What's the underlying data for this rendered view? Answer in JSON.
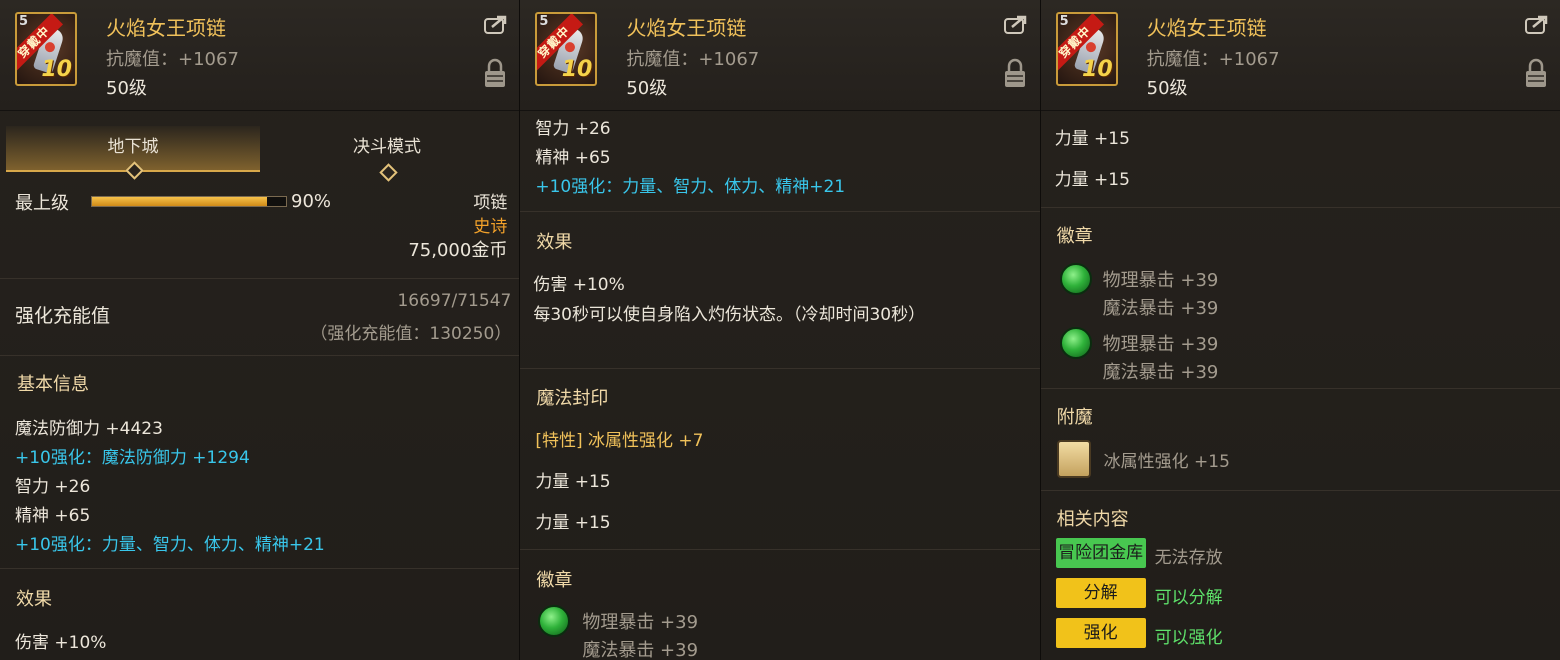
{
  "item": {
    "name": "火焰女王项链",
    "resist": "抗魔值：+1067",
    "level": "50级",
    "icon_level": "5",
    "icon_ribbon": "穿戴中",
    "icon_plus": "10"
  },
  "panel1": {
    "tabs": [
      "地下城",
      "决斗模式"
    ],
    "grade_label": "最上级",
    "grade_percent_text": "90%",
    "grade_fraction": 0.9,
    "type": "项链",
    "rarity": "史诗",
    "price": "75,000金币",
    "charge_label": "强化充能值",
    "charge_value": "16697/71547",
    "charge_total": "（强化充能值：130250）",
    "basic_title": "基本信息",
    "basic_stats": [
      "魔法防御力 +4423",
      "+10强化：魔法防御力 +1294",
      "智力 +26",
      "精神 +65",
      "+10强化：力量、智力、体力、精神+21"
    ],
    "effect_title": "效果",
    "effect_line_partial": "伤害 +10%"
  },
  "panel2": {
    "stats": [
      "智力 +26",
      "精神 +65",
      "+10强化：力量、智力、体力、精神+21"
    ],
    "effect_title": "效果",
    "effect_lines": [
      "伤害 +10%",
      "每30秒可以使自身陷入灼伤状态。（冷却时间30秒）"
    ],
    "seal_title": "魔法封印",
    "seal_lines": [
      "[特性] 冰属性强化 +7",
      "力量 +15",
      "力量 +15"
    ],
    "emblem_title": "徽章",
    "emblem_lines": [
      "物理暴击 +39",
      "魔法暴击 +39"
    ]
  },
  "panel3": {
    "seal_lines": [
      "力量 +15",
      "力量 +15"
    ],
    "emblem_title": "徽章",
    "emblems": [
      {
        "line1": "物理暴击 +39",
        "line2": "魔法暴击 +39"
      },
      {
        "line1": "物理暴击 +39",
        "line2": "魔法暴击 +39"
      }
    ],
    "enchant_title": "附魔",
    "enchant_line": "冰属性强化 +15",
    "related_title": "相关内容",
    "related": [
      {
        "button": "冒险团金库",
        "text": "无法存放"
      },
      {
        "button": "分解",
        "text": "可以分解"
      },
      {
        "button": "强化",
        "text": "可以强化"
      }
    ]
  },
  "icons": [
    "share-icon",
    "lock-icon",
    "emblem-gem-icon",
    "enchant-card-icon"
  ]
}
